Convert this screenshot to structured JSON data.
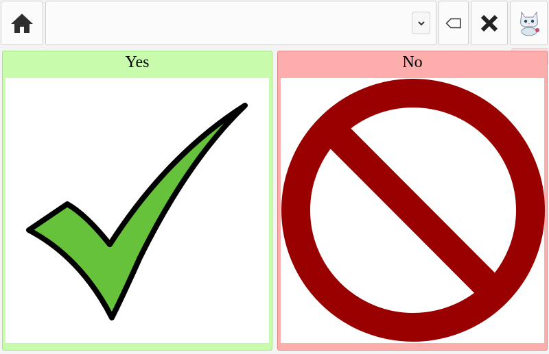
{
  "toolbar": {
    "home_icon": "home-icon",
    "utterance_text": "",
    "dropdown_icon": "chevron-down-icon",
    "backspace_icon": "backspace-icon",
    "clear_icon": "close-icon",
    "avatar_icon": "cat-avatar-icon"
  },
  "sidebar": {
    "tab_label": "sidebar"
  },
  "buttons": [
    {
      "label": "Yes",
      "icon": "checkmark-icon",
      "bg": "#c8fbab"
    },
    {
      "label": "No",
      "icon": "prohibited-icon",
      "bg": "#feadad"
    }
  ],
  "colors": {
    "check_fill": "#66c23b",
    "no_symbol": "#990000"
  }
}
